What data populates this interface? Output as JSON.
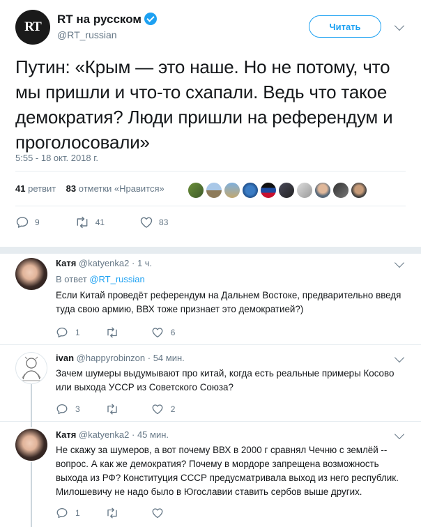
{
  "main_tweet": {
    "author_name": "RT на русском",
    "handle": "@RT_russian",
    "avatar_text": "RT",
    "follow_label": "Читать",
    "text": "Путин: «Крым — это наше. Но не потому, что мы пришли и что-то схапали. Ведь что такое демократия? Люди пришли на референдум и проголосовали»",
    "timestamp": "5:55 - 18 окт. 2018 г.",
    "retweets_count": "41",
    "retweets_label": "ретвит",
    "likes_count": "83",
    "likes_label": "отметки «Нравится»",
    "actions": {
      "replies": "9",
      "retweets": "41",
      "likes": "83"
    }
  },
  "replies": [
    {
      "name": "Катя",
      "handle": "@katyenka2",
      "time": "· 1 ч.",
      "reply_to_prefix": "В ответ",
      "reply_to_handle": "@RT_russian",
      "text": "Если Китай проведёт референдум на Дальнем Востоке, предварительно введя туда свою армию, ВВХ тоже признает это демократией?)",
      "actions": {
        "replies": "1",
        "retweets": "",
        "likes": "6"
      }
    },
    {
      "name": "ivan",
      "handle": "@happyrobinzon",
      "time": "· 54 мин.",
      "text": "Зачем шумеры выдумывают про китай, когда есть реальные примеры Косово или выхода УССР из Советского Союза?",
      "actions": {
        "replies": "3",
        "retweets": "",
        "likes": "2"
      }
    },
    {
      "name": "Катя",
      "handle": "@katyenka2",
      "time": "· 45 мин.",
      "text": "Не скажу за шумеров, а вот почему ВВХ в 2000 г сравнял Чечню с землёй -- вопрос. А как же демократия? Почему в мордоре запрещена возможность выхода из РФ? Конституция СССР предусматривала выход из него республик. Милошевичу не надо было в Югославии ставить сербов выше других.",
      "actions": {
        "replies": "1",
        "retweets": "",
        "likes": ""
      }
    }
  ],
  "colors": {
    "brand_blue": "#1da1f2",
    "text_primary": "#14171a",
    "text_secondary": "#657786",
    "separator": "#e6ecf0"
  }
}
